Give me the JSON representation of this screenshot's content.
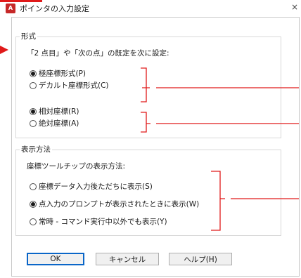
{
  "window": {
    "title": "ポインタの入力設定",
    "app_icon_letter": "A",
    "close_glyph": "×"
  },
  "format_group": {
    "label": "形式",
    "description": "「2 点目」や「次の点」の既定を次に設定:",
    "coord_options": [
      {
        "label": "極座標形式(P)",
        "selected": true
      },
      {
        "label": "デカルト座標形式(C)",
        "selected": false
      }
    ],
    "ref_options": [
      {
        "label": "相対座標(R)",
        "selected": true
      },
      {
        "label": "絶対座標(A)",
        "selected": false
      }
    ]
  },
  "display_group": {
    "label": "表示方法",
    "description": "座標ツールチップの表示方法:",
    "options": [
      {
        "label": "座標データ入力後ただちに表示(S)",
        "selected": false
      },
      {
        "label": "点入力のプロンプトが表示されたときに表示(W)",
        "selected": true
      },
      {
        "label": "常時 - コマンド実行中以外でも表示(Y)",
        "selected": false
      }
    ]
  },
  "buttons": {
    "ok": "OK",
    "cancel": "キャンセル",
    "help": "ヘルプ(H)"
  },
  "colors": {
    "annotation": "#e01a1a",
    "default_button_border": "#0a66c8",
    "app_icon": "#c62828"
  }
}
